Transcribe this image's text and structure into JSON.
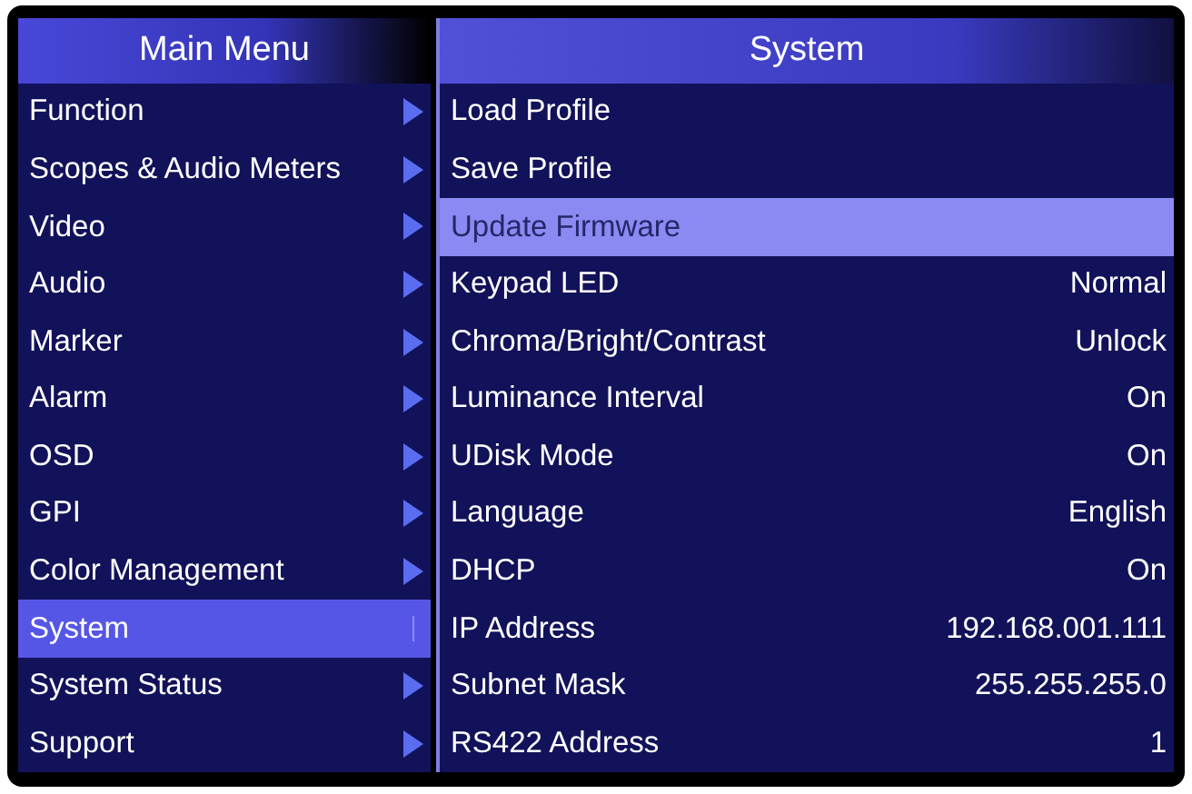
{
  "main_menu": {
    "title": "Main Menu",
    "items": [
      {
        "label": "Function",
        "selected": false
      },
      {
        "label": "Scopes & Audio Meters",
        "selected": false
      },
      {
        "label": "Video",
        "selected": false
      },
      {
        "label": "Audio",
        "selected": false
      },
      {
        "label": "Marker",
        "selected": false
      },
      {
        "label": "Alarm",
        "selected": false
      },
      {
        "label": "OSD",
        "selected": false
      },
      {
        "label": "GPI",
        "selected": false
      },
      {
        "label": "Color Management",
        "selected": false
      },
      {
        "label": "System",
        "selected": true
      },
      {
        "label": "System Status",
        "selected": false
      },
      {
        "label": "Support",
        "selected": false
      }
    ]
  },
  "submenu": {
    "title": "System",
    "items": [
      {
        "label": "Load Profile",
        "selected": false
      },
      {
        "label": "Save Profile",
        "selected": false
      },
      {
        "label": "Update Firmware",
        "selected": true
      },
      {
        "label": "Keypad LED",
        "value": "Normal",
        "selected": false
      },
      {
        "label": "Chroma/Bright/Contrast",
        "value": "Unlock",
        "selected": false
      },
      {
        "label": "Luminance Interval",
        "value": "On",
        "selected": false
      },
      {
        "label": "UDisk Mode",
        "value": "On",
        "selected": false
      },
      {
        "label": "Language",
        "value": "English",
        "selected": false
      },
      {
        "label": "DHCP",
        "value": "On",
        "selected": false
      },
      {
        "label": "IP Address",
        "value": "192.168.001.111",
        "selected": false
      },
      {
        "label": "Subnet Mask",
        "value": "255.255.255.0",
        "selected": false
      },
      {
        "label": "RS422 Address",
        "value": "1",
        "selected": false
      }
    ]
  }
}
